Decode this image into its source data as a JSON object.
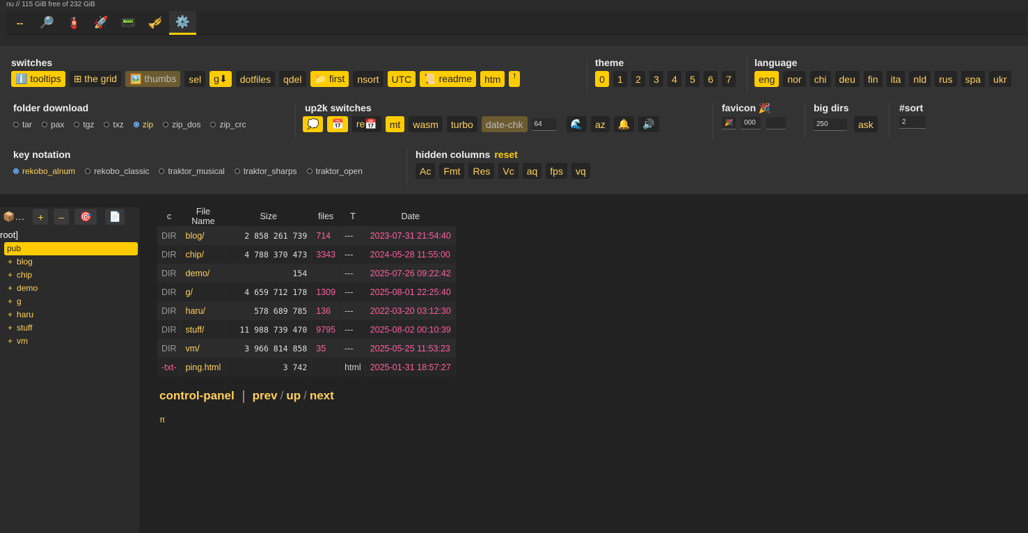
{
  "disk_info": "nu // 115 GiB free of 232 GiB",
  "tabs": [
    {
      "icon": "--",
      "name": "dash"
    },
    {
      "icon": "🔎",
      "name": "search"
    },
    {
      "icon": "🧯",
      "name": "extinguisher"
    },
    {
      "icon": "🚀",
      "name": "rocket"
    },
    {
      "icon": "📟",
      "name": "pager"
    },
    {
      "icon": "🎺",
      "name": "trumpet"
    },
    {
      "icon": "⚙️",
      "name": "gear"
    }
  ],
  "switches": {
    "title": "switches",
    "buttons": [
      "ℹ️ tooltips",
      "⊞ the grid",
      "🖼️ thumbs",
      "sel",
      "g⬇",
      "dotfiles",
      "qdel",
      "📁 first",
      "nsort",
      "UTC",
      "📜 readme",
      "htm",
      "ꜝ"
    ]
  },
  "theme": {
    "title": "theme",
    "options": [
      "0",
      "1",
      "2",
      "3",
      "4",
      "5",
      "6",
      "7"
    ]
  },
  "language": {
    "title": "language",
    "options": [
      "eng",
      "nor",
      "chi",
      "deu",
      "fin",
      "ita",
      "nld",
      "rus",
      "spa",
      "ukr"
    ]
  },
  "folder_download": {
    "title": "folder download",
    "options": [
      "tar",
      "pax",
      "tgz",
      "txz",
      "zip",
      "zip_dos",
      "zip_crc"
    ],
    "selected": "zip"
  },
  "up2k": {
    "title": "up2k switches",
    "buttons": [
      "💭",
      "📅",
      "re📅",
      "mt",
      "wasm",
      "turbo",
      "date-chk"
    ],
    "threads": "64",
    "buttons2": [
      "🌊",
      "az",
      "🔔",
      "🔊"
    ]
  },
  "favicon": {
    "title": "favicon 🎉",
    "emoji": "🎉",
    "value": "000",
    "value2": ""
  },
  "big_dirs": {
    "title": "big dirs",
    "value": "250",
    "ask": "ask"
  },
  "sort": {
    "title": "#sort",
    "value": "2"
  },
  "key_notation": {
    "title": "key notation",
    "options": [
      "rekobo_alnum",
      "rekobo_classic",
      "traktor_musical",
      "traktor_sharps",
      "traktor_open"
    ],
    "selected": "rekobo_alnum"
  },
  "hidden_columns": {
    "title": "hidden columns",
    "reset": "reset",
    "buttons": [
      "Ac",
      "Fmt",
      "Res",
      "Vc",
      "aq",
      "fps",
      "vq"
    ]
  },
  "tree": {
    "tools": [
      "📦…",
      "+",
      "–",
      "🎯",
      "📄"
    ],
    "root": "root]",
    "items": [
      "pub",
      "blog",
      "chip",
      "demo",
      "g",
      "haru",
      "stuff",
      "vm"
    ],
    "plus": "+"
  },
  "table": {
    "headers": [
      "c",
      "File Name",
      "Size",
      "files",
      "T",
      "Date"
    ],
    "rows": [
      {
        "c": "DIR",
        "name": "blog/",
        "size": "2 858 261 739",
        "files": "714",
        "t": "---",
        "date": "2023-07-31 21:54:40"
      },
      {
        "c": "DIR",
        "name": "chip/",
        "size": "4 788 370 473",
        "files": "3343",
        "t": "---",
        "date": "2024-05-28 11:55:00"
      },
      {
        "c": "DIR",
        "name": "demo/",
        "size": "154",
        "files": "",
        "t": "---",
        "date": "2025-07-26 09:22:42"
      },
      {
        "c": "DIR",
        "name": "g/",
        "size": "4 659 712 178",
        "files": "1309",
        "t": "---",
        "date": "2025-08-01 22:25:40"
      },
      {
        "c": "DIR",
        "name": "haru/",
        "size": "578 689 785",
        "files": "136",
        "t": "---",
        "date": "2022-03-20 03:12:30"
      },
      {
        "c": "DIR",
        "name": "stuff/",
        "size": "11 988 739 470",
        "files": "9795",
        "t": "---",
        "date": "2025-08-02 00:10:39"
      },
      {
        "c": "DIR",
        "name": "vm/",
        "size": "3 966 814 858",
        "files": "35",
        "t": "---",
        "date": "2025-05-25 11:53:23"
      },
      {
        "c": "-txt-",
        "name": "ping.html",
        "size": "3 742",
        "files": "",
        "t": "html",
        "date": "2025-01-31 18:57:27"
      }
    ]
  },
  "nav": {
    "control_panel": "control-panel",
    "prev": "prev",
    "up": "up",
    "next": "next",
    "slash": "/"
  },
  "footer_symbol": "π",
  "colors": {
    "accent": "#ffcc00",
    "link": "#ffd05a",
    "pink": "#ff5fa0",
    "bg": "#222222",
    "panel": "#333333"
  }
}
